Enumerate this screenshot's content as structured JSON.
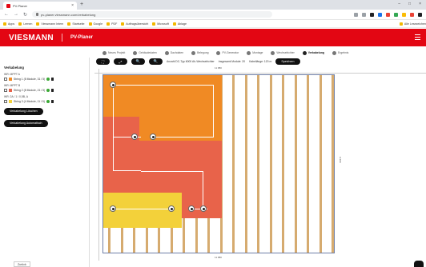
{
  "browser": {
    "tab_title": "PV-Planer",
    "url": "pv-planer.viessmann.com/verkabelung",
    "bookmarks": [
      "Apps",
      "Lernen",
      "Viessmann Intern",
      "Startseite",
      "Google",
      "PDF",
      "Auftragsübersicht",
      "Microsoft",
      "Ablage",
      "Alle Lesezeichen"
    ],
    "ext_colors": [
      "#9aa0a6",
      "#9aa0a6",
      "#202124",
      "#1a73e8",
      "#ea4335",
      "#34a853",
      "#fbbc04",
      "#ea4335",
      "#202124"
    ]
  },
  "app": {
    "logo": "VIESMANN",
    "title": "PV-Planer",
    "brand_color": "#e30613"
  },
  "stepper": [
    {
      "label": "Neues Projekt",
      "active": false
    },
    {
      "label": "Gebäudedaten",
      "active": false
    },
    {
      "label": "Dachdaten",
      "active": false
    },
    {
      "label": "Belegung",
      "active": false
    },
    {
      "label": "PV-Generator",
      "active": false
    },
    {
      "label": "Montage",
      "active": false
    },
    {
      "label": "Wechselrichter",
      "active": false
    },
    {
      "label": "Verkabelung",
      "active": true
    },
    {
      "label": "Ergebnis",
      "active": false
    }
  ],
  "sidebar": {
    "title": "Verkabelung",
    "groups": [
      {
        "header": "WR: MPPT A",
        "item": "String 1 (8 Module, 31 / 5)",
        "swatch": "#f08a24"
      },
      {
        "header": "WR: MPPT B",
        "item": "String 2 (8 Module, 21 / 5)",
        "swatch": "#e8634a"
      },
      {
        "header": "WR: 2A / 1 / 0,5B, A",
        "item": "String 3 (4 Module, 11 / 5)",
        "swatch": "#f3d13a"
      }
    ],
    "btn_delete": "Verkabelung Löschen",
    "btn_auto": "Verkabelung Automatisch"
  },
  "toolbar": {
    "btn1": "⛶",
    "btn2": "⤢",
    "btn3": "🔍",
    "btn4": "🔍",
    "label1": "Anzahl DC-Typ 6000 Ah-Wechselrichter",
    "label2": "Insgesamt Module: 20",
    "label3": "Kabellänge: 120 m",
    "save": "Speichern"
  },
  "canvas": {
    "dim_top": "11 880",
    "dim_right": "9 200",
    "dim_bottom": "11 880",
    "colors": {
      "string1": "#f08a24",
      "string2": "#e8634a",
      "string3": "#f3d13a",
      "batten": "#cf9c56",
      "roof_edge": "#6f7fa6"
    }
  },
  "footer": {
    "left_label": "Zurück"
  }
}
